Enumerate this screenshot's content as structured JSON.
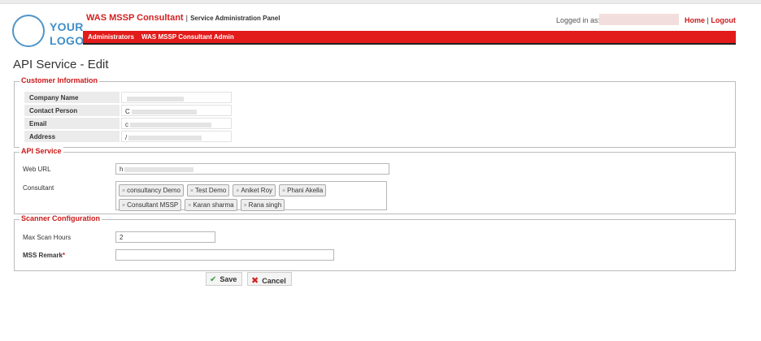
{
  "logo": {
    "line1": "YOUR",
    "line2": "LOGO"
  },
  "header": {
    "app_name": "WAS MSSP Consultant",
    "separator": "|",
    "app_subtitle": "Service Administration Panel",
    "logged_in_label": "Logged in as:",
    "home_link": "Home",
    "link_separator": "|",
    "logout_link": "Logout"
  },
  "menu": {
    "administrators": "Administrators",
    "consultant_admin": "WAS MSSP Consultant Admin"
  },
  "page": {
    "title": "API Service - Edit"
  },
  "customer_info": {
    "legend": "Customer Information",
    "rows": [
      {
        "label": "Company Name",
        "value": ""
      },
      {
        "label": "Contact Person",
        "value": "C"
      },
      {
        "label": "Email",
        "value": "c"
      },
      {
        "label": "Address",
        "value": "/"
      }
    ]
  },
  "api_service": {
    "legend": "API Service",
    "web_url_label": "Web URL",
    "web_url_value": "h",
    "consultant_label": "Consultant",
    "consultants": [
      "consultancy Demo",
      "Test Demo",
      "Aniket Roy",
      "Phani Akella",
      "Consultant MSSP",
      "Karan sharma",
      "Rana singh"
    ],
    "tag_remove_glyph": "×"
  },
  "scanner_config": {
    "legend": "Scanner Configuration",
    "max_scan_hours_label": "Max Scan Hours",
    "max_scan_hours_value": "2",
    "mss_remark_label": "MSS Remark",
    "required_marker": "*",
    "mss_remark_value": ""
  },
  "actions": {
    "save_label": "Save",
    "cancel_label": "Cancel"
  },
  "colors": {
    "brand_red": "#e21b1b",
    "logo_blue": "#3f8fc9",
    "legend_red": "#cc1818"
  },
  "icons": {
    "save": "check-icon",
    "cancel": "cross-icon"
  }
}
